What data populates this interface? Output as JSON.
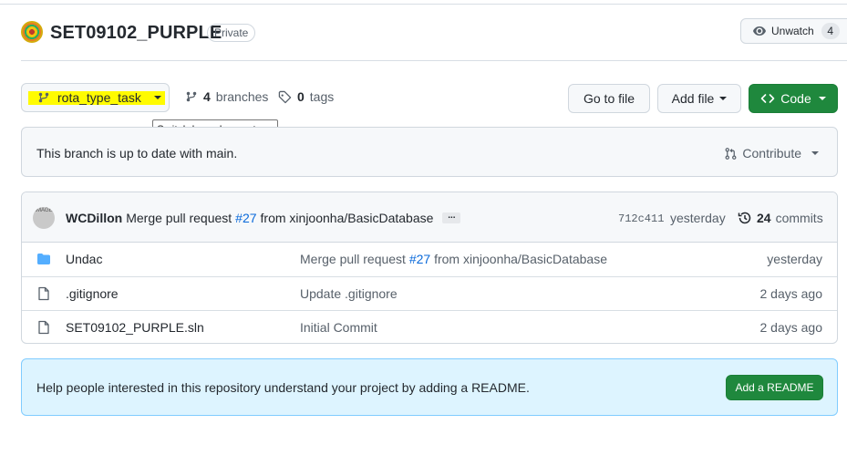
{
  "repo": {
    "name": "SET09102_PURPLE",
    "visibility": "Private",
    "watch_label": "Unwatch",
    "watch_count": "4"
  },
  "toolbar": {
    "branch": "rota_type_task",
    "branches_count": "4",
    "branches_label": "branches",
    "tags_count": "0",
    "tags_label": "tags",
    "tooltip": "Switch branches or tags",
    "go_to_file": "Go to file",
    "add_file": "Add file",
    "code": "Code"
  },
  "status": {
    "message": "This branch is up to date with main.",
    "contribute": "Contribute"
  },
  "latest_commit": {
    "avatar_text": "IMAGE",
    "author": "WCDillon",
    "message_prefix": "Merge pull request",
    "pr": "#27",
    "message_suffix": "from xinjoonha/BasicDatabase",
    "ellipsis": "...",
    "sha": "712c411",
    "time": "yesterday",
    "commits_count": "24",
    "commits_label": "commits"
  },
  "files": [
    {
      "name": "Undac",
      "type": "folder",
      "msg_prefix": "Merge pull request",
      "msg_link": "#27",
      "msg_suffix": "from xinjoonha/BasicDatabase",
      "age": "yesterday"
    },
    {
      "name": ".gitignore",
      "type": "file",
      "msg_prefix": "Update .gitignore",
      "msg_link": "",
      "msg_suffix": "",
      "age": "2 days ago"
    },
    {
      "name": "SET09102_PURPLE.sln",
      "type": "file",
      "msg_prefix": "Initial Commit",
      "msg_link": "",
      "msg_suffix": "",
      "age": "2 days ago"
    }
  ],
  "readme": {
    "message": "Help people interested in this repository understand your project by adding a README.",
    "button": "Add a README"
  },
  "colors": {
    "green": "#1f883d",
    "link": "#0969da",
    "highlight": "#fffb00",
    "readme_bg": "#ddf4ff"
  }
}
